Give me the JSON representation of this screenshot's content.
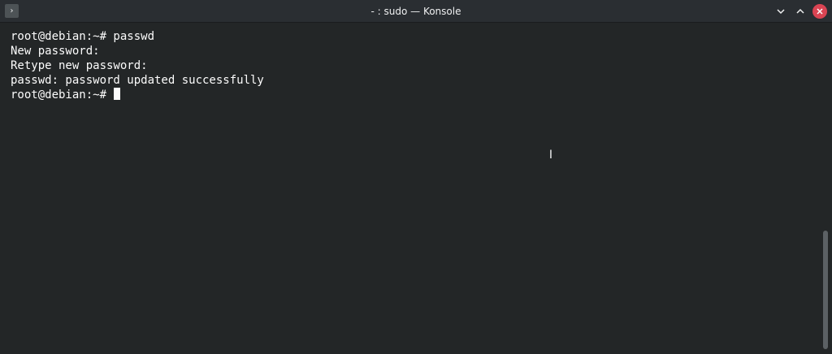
{
  "window": {
    "title": "- : sudo — Konsole",
    "app_icon": "terminal-prompt-icon",
    "controls": [
      "minimize-icon",
      "maximize-icon",
      "close-icon"
    ],
    "colors": {
      "background": "#232627",
      "titlebar": "#2a2e32",
      "text": "#fcfcfc",
      "close": "#da4453"
    }
  },
  "terminal": {
    "lines": [
      "root@debian:~# passwd",
      "New password:",
      "Retype new password:",
      "passwd: password updated successfully",
      "root@debian:~# "
    ]
  }
}
